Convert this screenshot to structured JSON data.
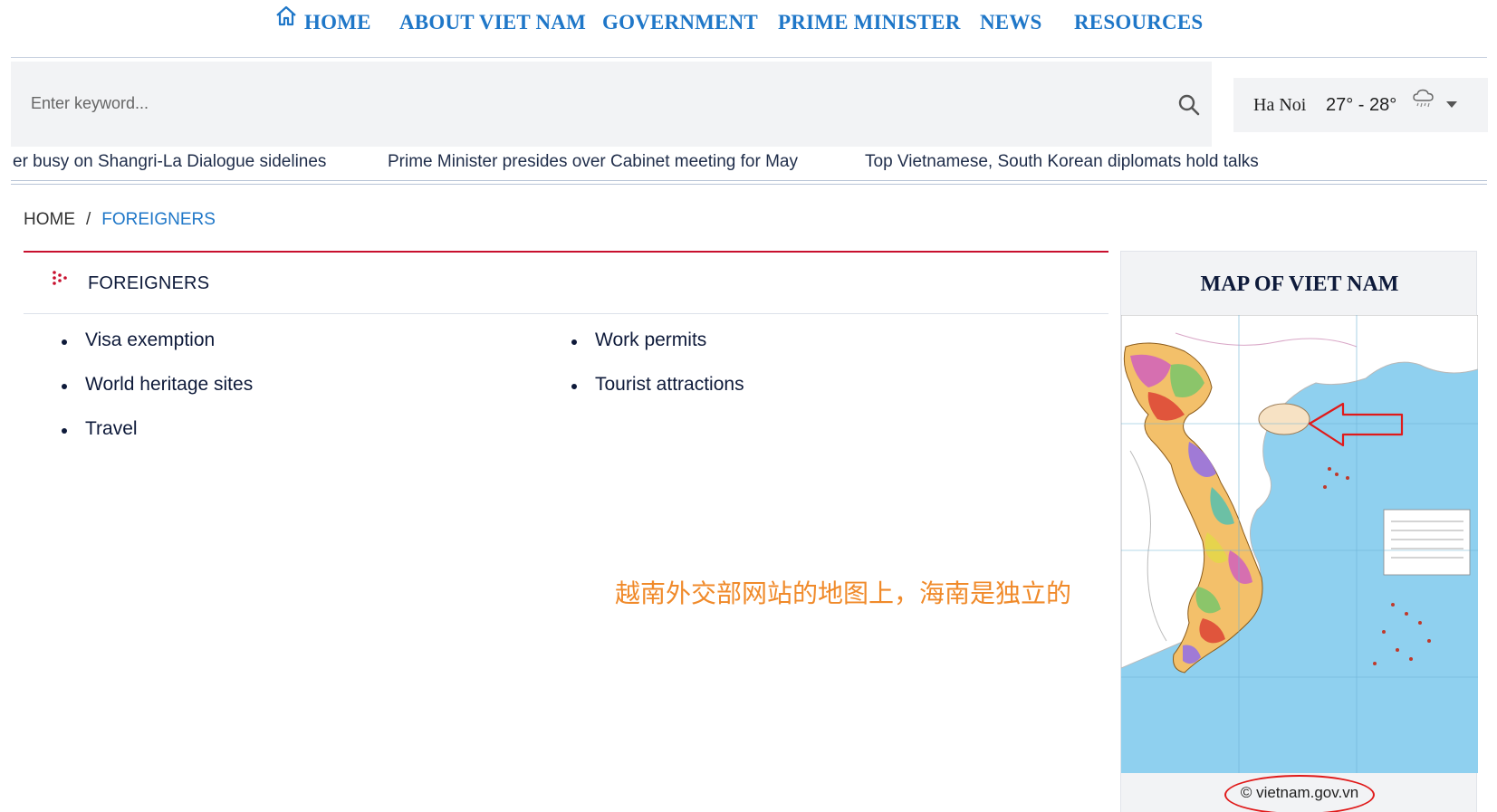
{
  "nav": {
    "items": [
      "HOME",
      "ABOUT VIET NAM",
      "GOVERNMENT",
      "PRIME MINISTER",
      "NEWS",
      "RESOURCES"
    ]
  },
  "search": {
    "placeholder": "Enter keyword..."
  },
  "weather": {
    "city": "Ha Noi",
    "temp": "27° - 28°"
  },
  "ticker": {
    "items": [
      "er busy on Shangri-La Dialogue sidelines",
      "Prime Minister presides over Cabinet meeting for May",
      "Top Vietnamese, South Korean diplomats hold talks"
    ]
  },
  "breadcrumb": {
    "home": "HOME",
    "separator": "/",
    "current": "FOREIGNERS"
  },
  "section": {
    "title": "FOREIGNERS",
    "links_left": [
      "Visa exemption",
      "World heritage sites",
      "Travel"
    ],
    "links_right": [
      "Work permits",
      "Tourist attractions"
    ]
  },
  "annotation": {
    "text": "越南外交部网站的地图上，海南是独立的"
  },
  "map_card": {
    "title": "MAP OF VIET NAM",
    "credit": "© vietnam.gov.vn"
  },
  "colors": {
    "nav_blue": "#1f77c8",
    "accent_red": "#c8102e",
    "annotation_orange": "#f08a2a",
    "sea_blue": "#8fd0ef"
  }
}
